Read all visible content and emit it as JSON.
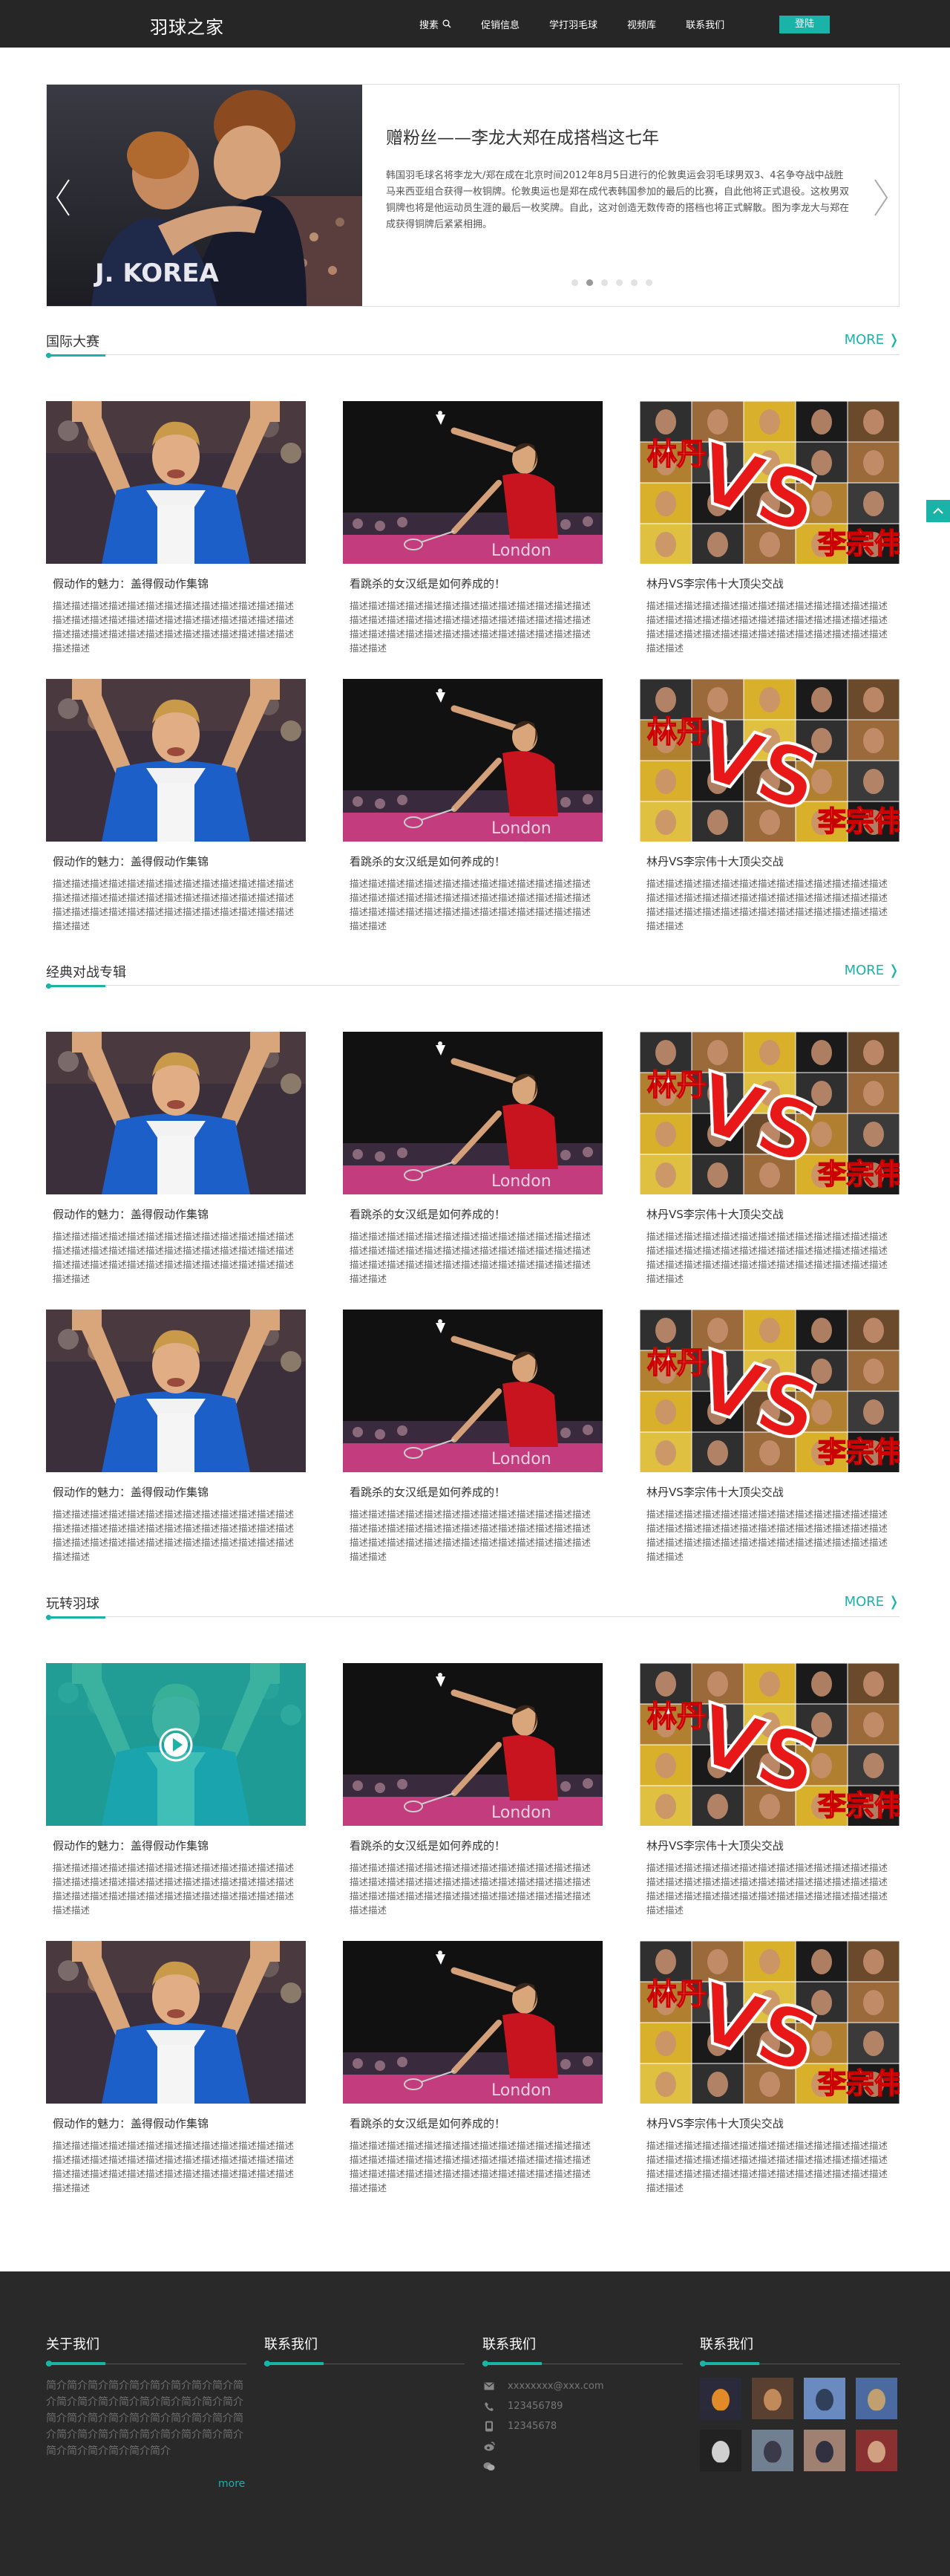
{
  "header": {
    "logo": "羽球之家",
    "nav": [
      "搜素",
      "促销信息",
      "学打羽毛球",
      "视频库",
      "联系我们"
    ],
    "login": "登陆"
  },
  "hero": {
    "title": "赠粉丝——李龙大郑在成搭档这七年",
    "desc": "韩国羽毛球名将李龙大/郑在成在北京时间2012年8月5日进行的伦敦奥运会羽毛球男双3、4名争夺战中战胜马来西亚组合获得一枚铜牌。伦敦奥运也是郑在成代表韩国参加的最后的比赛，自此他将正式退役。这枚男双铜牌也将是他运动员生涯的最后一枚奖牌。自此，这对创造无数传奇的搭档也将正式解散。图为李龙大与郑在成获得铜牌后紧紧相拥。",
    "dot_count": 6,
    "active_dot": 1
  },
  "sections": [
    {
      "title": "国际大赛",
      "more": "MORE",
      "cards": [
        {
          "title": "假动作的魅力：盖得假动作集锦",
          "desc": "描述描述描述描述描述描述描述描述描述描述描述描述描述描述描述描述描述描述描述描述描述描述描述描述描述描述描述描述描述描述描述描述描述描述描述描述描述描述描述描述描述",
          "img": "player"
        },
        {
          "title": "看跳杀的女汉纸是如何养成的！",
          "desc": "描述描述描述描述描述描述描述描述描述描述描述描述描述描述描述描述描述描述描述描述描述描述描述描述描述描述描述描述描述描述描述描述描述描述描述描述描述描述描述描述描述",
          "img": "woman"
        },
        {
          "title": "林丹VS李宗伟十大顶尖交战",
          "desc": "描述描述描述描述描述描述描述描述描述描述描述描述描述描述描述描述描述描述描述描述描述描述描述描述描述描述描述描述描述描述描述描述描述描述描述描述描述描述描述描述描述",
          "img": "vs"
        },
        {
          "title": "假动作的魅力：盖得假动作集锦",
          "desc": "描述描述描述描述描述描述描述描述描述描述描述描述描述描述描述描述描述描述描述描述描述描述描述描述描述描述描述描述描述描述描述描述描述描述描述描述描述描述描述描述描述",
          "img": "player"
        },
        {
          "title": "看跳杀的女汉纸是如何养成的！",
          "desc": "描述描述描述描述描述描述描述描述描述描述描述描述描述描述描述描述描述描述描述描述描述描述描述描述描述描述描述描述描述描述描述描述描述描述描述描述描述描述描述描述描述",
          "img": "woman"
        },
        {
          "title": "林丹VS李宗伟十大顶尖交战",
          "desc": "描述描述描述描述描述描述描述描述描述描述描述描述描述描述描述描述描述描述描述描述描述描述描述描述描述描述描述描述描述描述描述描述描述描述描述描述描述描述描述描述描述",
          "img": "vs"
        }
      ]
    },
    {
      "title": "经典对战专辑",
      "more": "MORE",
      "cards": [
        {
          "title": "假动作的魅力：盖得假动作集锦",
          "desc": "描述描述描述描述描述描述描述描述描述描述描述描述描述描述描述描述描述描述描述描述描述描述描述描述描述描述描述描述描述描述描述描述描述描述描述描述描述描述描述描述描述",
          "img": "player"
        },
        {
          "title": "看跳杀的女汉纸是如何养成的！",
          "desc": "描述描述描述描述描述描述描述描述描述描述描述描述描述描述描述描述描述描述描述描述描述描述描述描述描述描述描述描述描述描述描述描述描述描述描述描述描述描述描述描述描述",
          "img": "woman"
        },
        {
          "title": "林丹VS李宗伟十大顶尖交战",
          "desc": "描述描述描述描述描述描述描述描述描述描述描述描述描述描述描述描述描述描述描述描述描述描述描述描述描述描述描述描述描述描述描述描述描述描述描述描述描述描述描述描述描述",
          "img": "vs"
        },
        {
          "title": "假动作的魅力：盖得假动作集锦",
          "desc": "描述描述描述描述描述描述描述描述描述描述描述描述描述描述描述描述描述描述描述描述描述描述描述描述描述描述描述描述描述描述描述描述描述描述描述描述描述描述描述描述描述",
          "img": "player"
        },
        {
          "title": "看跳杀的女汉纸是如何养成的！",
          "desc": "描述描述描述描述描述描述描述描述描述描述描述描述描述描述描述描述描述描述描述描述描述描述描述描述描述描述描述描述描述描述描述描述描述描述描述描述描述描述描述描述描述",
          "img": "woman"
        },
        {
          "title": "林丹VS李宗伟十大顶尖交战",
          "desc": "描述描述描述描述描述描述描述描述描述描述描述描述描述描述描述描述描述描述描述描述描述描述描述描述描述描述描述描述描述描述描述描述描述描述描述描述描述描述描述描述描述",
          "img": "vs"
        }
      ]
    },
    {
      "title": "玩转羽球",
      "more": "MORE",
      "cards": [
        {
          "title": "假动作的魅力：盖得假动作集锦",
          "desc": "描述描述描述描述描述描述描述描述描述描述描述描述描述描述描述描述描述描述描述描述描述描述描述描述描述描述描述描述描述描述描述描述描述描述描述描述描述描述描述描述描述",
          "img": "player-video"
        },
        {
          "title": "看跳杀的女汉纸是如何养成的！",
          "desc": "描述描述描述描述描述描述描述描述描述描述描述描述描述描述描述描述描述描述描述描述描述描述描述描述描述描述描述描述描述描述描述描述描述描述描述描述描述描述描述描述描述",
          "img": "woman"
        },
        {
          "title": "林丹VS李宗伟十大顶尖交战",
          "desc": "描述描述描述描述描述描述描述描述描述描述描述描述描述描述描述描述描述描述描述描述描述描述描述描述描述描述描述描述描述描述描述描述描述描述描述描述描述描述描述描述描述",
          "img": "vs"
        },
        {
          "title": "假动作的魅力：盖得假动作集锦",
          "desc": "描述描述描述描述描述描述描述描述描述描述描述描述描述描述描述描述描述描述描述描述描述描述描述描述描述描述描述描述描述描述描述描述描述描述描述描述描述描述描述描述描述",
          "img": "player"
        },
        {
          "title": "看跳杀的女汉纸是如何养成的！",
          "desc": "描述描述描述描述描述描述描述描述描述描述描述描述描述描述描述描述描述描述描述描述描述描述描述描述描述描述描述描述描述描述描述描述描述描述描述描述描述描述描述描述描述",
          "img": "woman"
        },
        {
          "title": "林丹VS李宗伟十大顶尖交战",
          "desc": "描述描述描述描述描述描述描述描述描述描述描述描述描述描述描述描述描述描述描述描述描述描述描述描述描述描述描述描述描述描述描述描述描述描述描述描述描述描述描述描述描述",
          "img": "vs"
        }
      ]
    }
  ],
  "vs_image_text": {
    "left": "林丹",
    "mid": "VS",
    "right": "李宗伟"
  },
  "footer": {
    "about_title": "关于我们",
    "about_text": "简介简介简介简介简介简介简介简介简介简介简介简介简介简介简介简介简介简介简介简介简介简介简介简介简介简介简介简介简介简介简介简介简介简介简介简介简介简介简介简介简介简介简介简介",
    "about_more": "more",
    "contact_title_1": "联系我们",
    "contact_title_2": "联系我们",
    "contacts": [
      {
        "icon": "mail-icon",
        "text": "xxxxxxxx@xxx.com"
      },
      {
        "icon": "phone-icon",
        "text": "123456789"
      },
      {
        "icon": "mobile-icon",
        "text": "12345678"
      },
      {
        "icon": "weibo-icon",
        "text": ""
      },
      {
        "icon": "wechat-icon",
        "text": ""
      }
    ],
    "gallery_title": "联系我们",
    "gallery_count": 8
  },
  "colors": {
    "accent": "#19b3a8",
    "header_bg": "#262626",
    "footer_bg": "#292929"
  }
}
